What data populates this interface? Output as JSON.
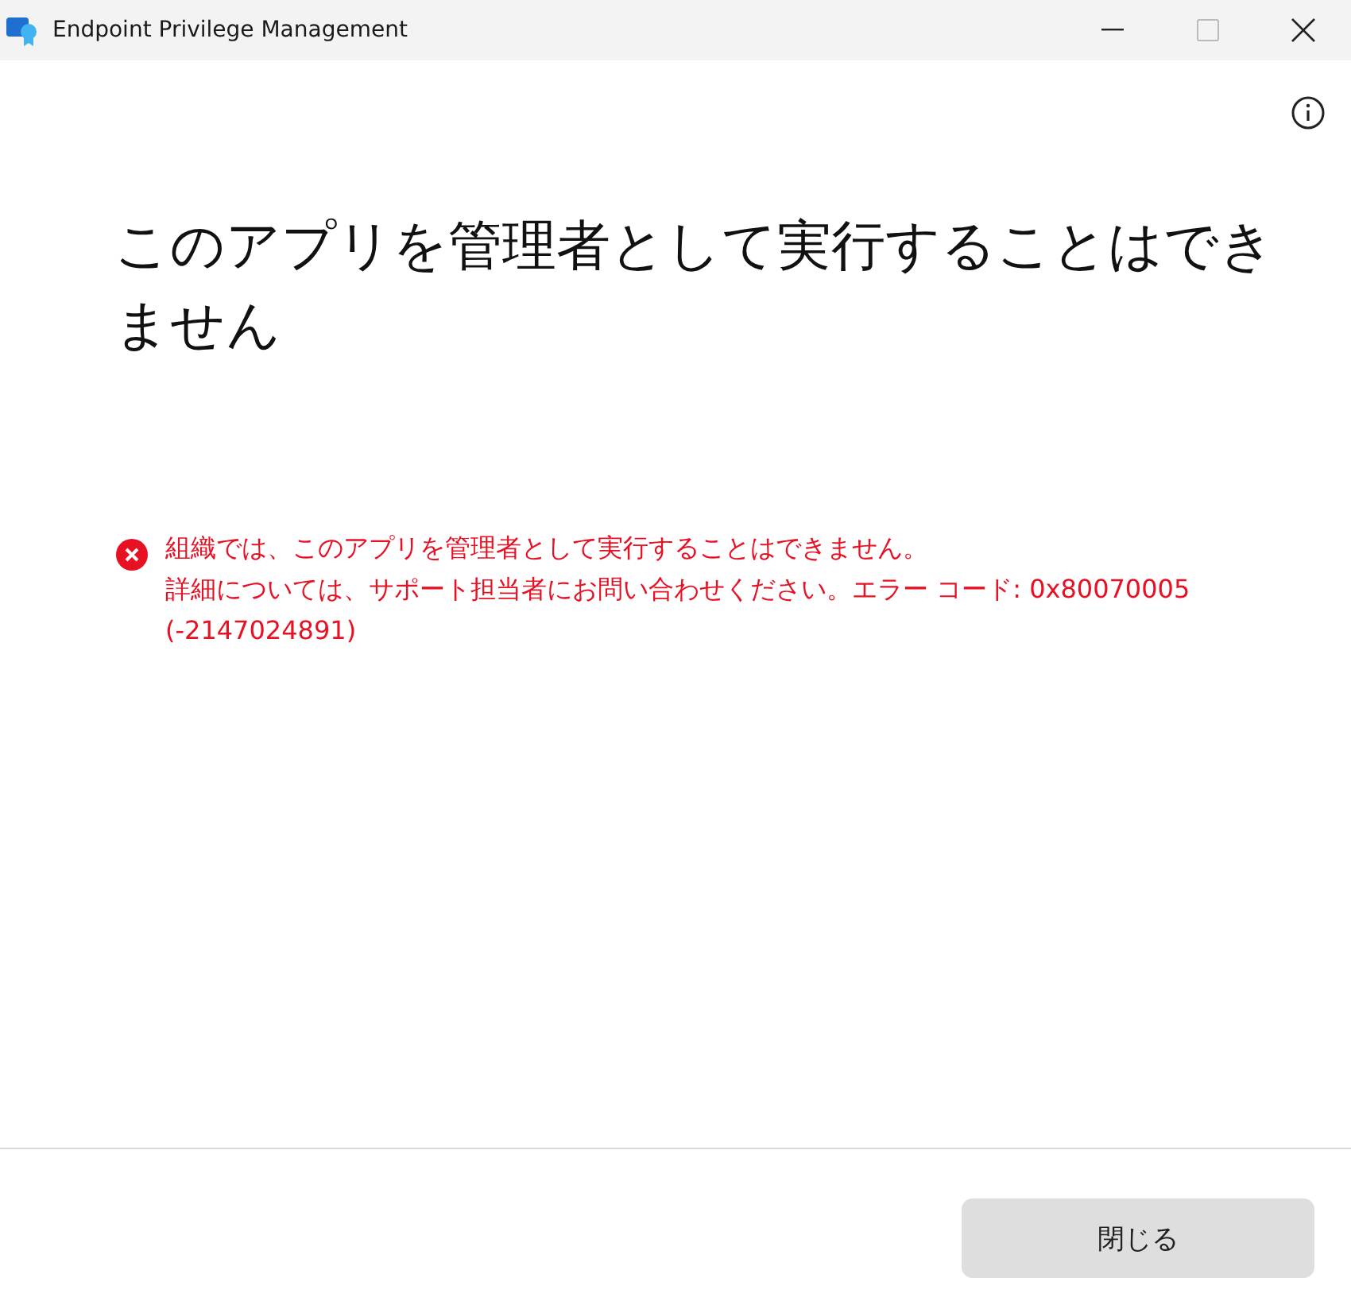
{
  "window": {
    "title": "Endpoint Privilege Management"
  },
  "heading_lines": [
    "このアプリを管理者として実行することはでき",
    "ません"
  ],
  "error": {
    "lines": [
      "組織では、このアプリを管理者として実行することはできません。",
      "詳細については、サポート担当者にお問い合わせください。エラー コード: 0x80070005",
      "(-2147024891)"
    ]
  },
  "buttons": [
    "閉じる"
  ]
}
